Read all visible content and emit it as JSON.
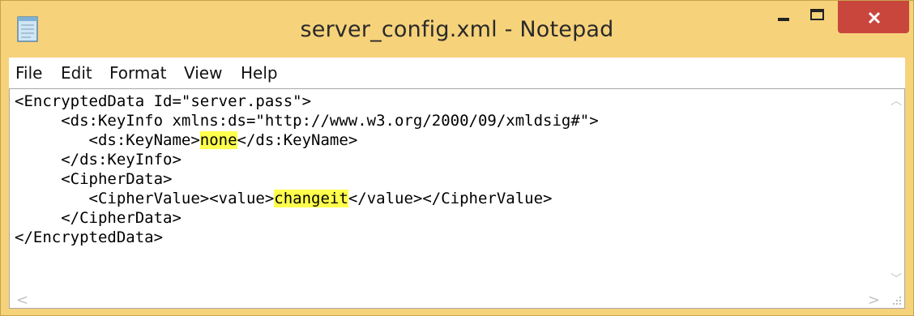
{
  "window": {
    "title": "server_config.xml - Notepad",
    "app_icon": "notepad-icon",
    "controls": {
      "minimize": "minimize-icon",
      "maximize": "maximize-icon",
      "close": "close-icon"
    },
    "colors": {
      "frame": "#f6d27a",
      "close_button": "#c9463d",
      "highlight": "#ffff4d"
    }
  },
  "menu": {
    "items": [
      {
        "label": "File"
      },
      {
        "label": "Edit"
      },
      {
        "label": "Format"
      },
      {
        "label": "View"
      },
      {
        "label": "Help"
      }
    ]
  },
  "editor": {
    "lines": [
      {
        "before": "<EncryptedData Id=\"server.pass\">",
        "highlight": "",
        "after": ""
      },
      {
        "before": "     <ds:KeyInfo xmlns:ds=\"http://www.w3.org/2000/09/xmldsig#\">",
        "highlight": "",
        "after": ""
      },
      {
        "before": "        <ds:KeyName>",
        "highlight": "none",
        "after": "</ds:KeyName>"
      },
      {
        "before": "     </ds:KeyInfo>",
        "highlight": "",
        "after": ""
      },
      {
        "before": "     <CipherData>",
        "highlight": "",
        "after": ""
      },
      {
        "before": "        <CipherValue><value>",
        "highlight": "changeit",
        "after": "</value></CipherValue>"
      },
      {
        "before": "     </CipherData>",
        "highlight": "",
        "after": ""
      },
      {
        "before": "</EncryptedData>",
        "highlight": "",
        "after": ""
      }
    ]
  }
}
